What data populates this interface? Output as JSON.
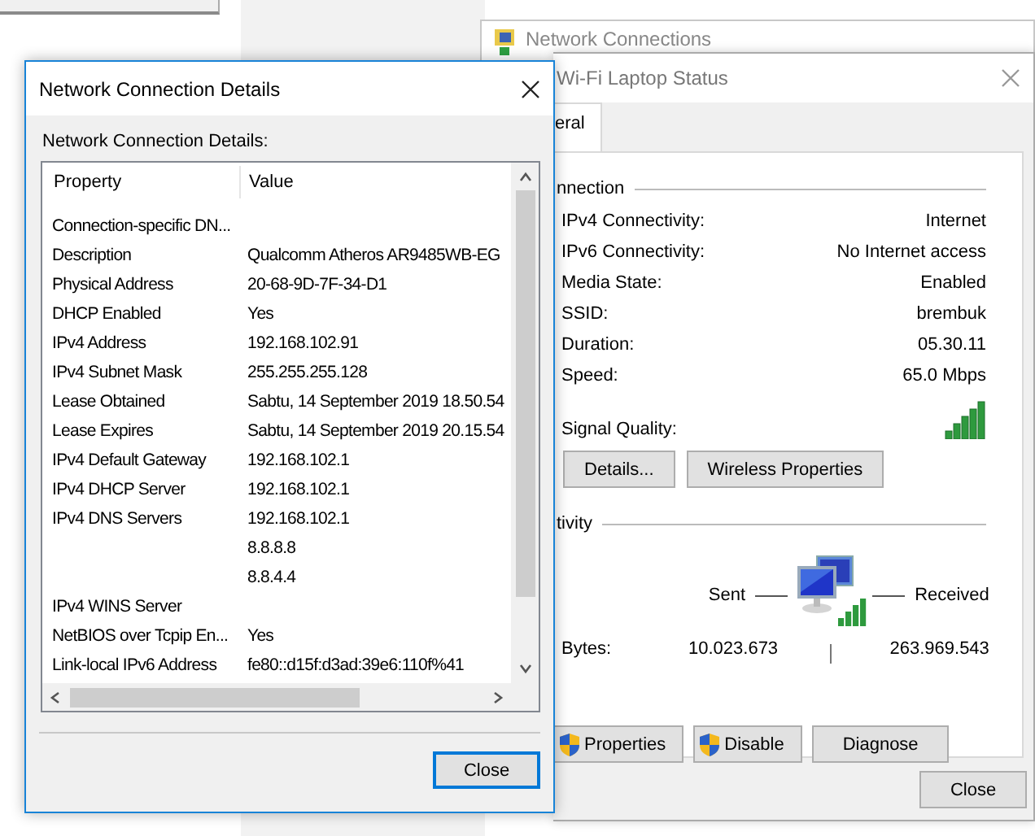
{
  "background_window": {
    "title": "Network Connections"
  },
  "details_dialog": {
    "title": "Network Connection Details",
    "caption": "Network Connection Details:",
    "columns": [
      "Property",
      "Value"
    ],
    "rows": [
      {
        "property": "Connection-specific DN..."
      },
      {
        "property": "Description",
        "value": "Qualcomm Atheros AR9485WB-EG"
      },
      {
        "property": "Physical Address",
        "value": "20-68-9D-7F-34-D1"
      },
      {
        "property": "DHCP Enabled",
        "value": "Yes"
      },
      {
        "property": "IPv4 Address",
        "value": "192.168.102.91"
      },
      {
        "property": "IPv4 Subnet Mask",
        "value": "255.255.255.128"
      },
      {
        "property": "Lease Obtained",
        "value": "Sabtu, 14 September 2019 18.50.54"
      },
      {
        "property": "Lease Expires",
        "value": "Sabtu, 14 September 2019 20.15.54"
      },
      {
        "property": "IPv4 Default Gateway",
        "value": "192.168.102.1"
      },
      {
        "property": "IPv4 DHCP Server",
        "value": "192.168.102.1"
      },
      {
        "property": "IPv4 DNS Servers",
        "value": "192.168.102.1"
      },
      {
        "value": "8.8.8.8"
      },
      {
        "value": "8.8.4.4"
      },
      {
        "property": "IPv4 WINS Server"
      },
      {
        "property": "NetBIOS over Tcpip En...",
        "value": "Yes"
      },
      {
        "property": "Link-local IPv6 Address",
        "value": "fe80::d15f:d3ad:39e6:110f%41"
      }
    ],
    "close": {
      "label": "Close",
      "default": true
    }
  },
  "status_dialog": {
    "title": "Wi-Fi Laptop Status",
    "tabs": [
      {
        "label": "eral",
        "selected": true
      }
    ],
    "connection": {
      "heading": "nnection",
      "rows": [
        {
          "label": "IPv4 Connectivity:",
          "value": "Internet"
        },
        {
          "label": "IPv6 Connectivity:",
          "value": "No Internet access"
        },
        {
          "label": "Media State:",
          "value": "Enabled"
        },
        {
          "label": "SSID:",
          "value": "brembuk"
        },
        {
          "label": "Duration:",
          "value": "05.30.11"
        },
        {
          "label": "Speed:",
          "value": "65.0 Mbps"
        }
      ],
      "signal_label": "Signal Quality:"
    },
    "buttons": [
      "Details...",
      "Wireless Properties"
    ],
    "activity": {
      "heading": "tivity",
      "sent_label": "Sent",
      "received_label": "Received",
      "bytes_label": "Bytes:",
      "sent": "10.023.673",
      "received": "263.969.543"
    },
    "action_buttons": [
      {
        "label": "Properties",
        "shield": true
      },
      {
        "label": "Disable",
        "shield": true
      },
      {
        "label": "Diagnose",
        "shield": false
      }
    ],
    "close": {
      "label": "Close",
      "default": false
    }
  }
}
